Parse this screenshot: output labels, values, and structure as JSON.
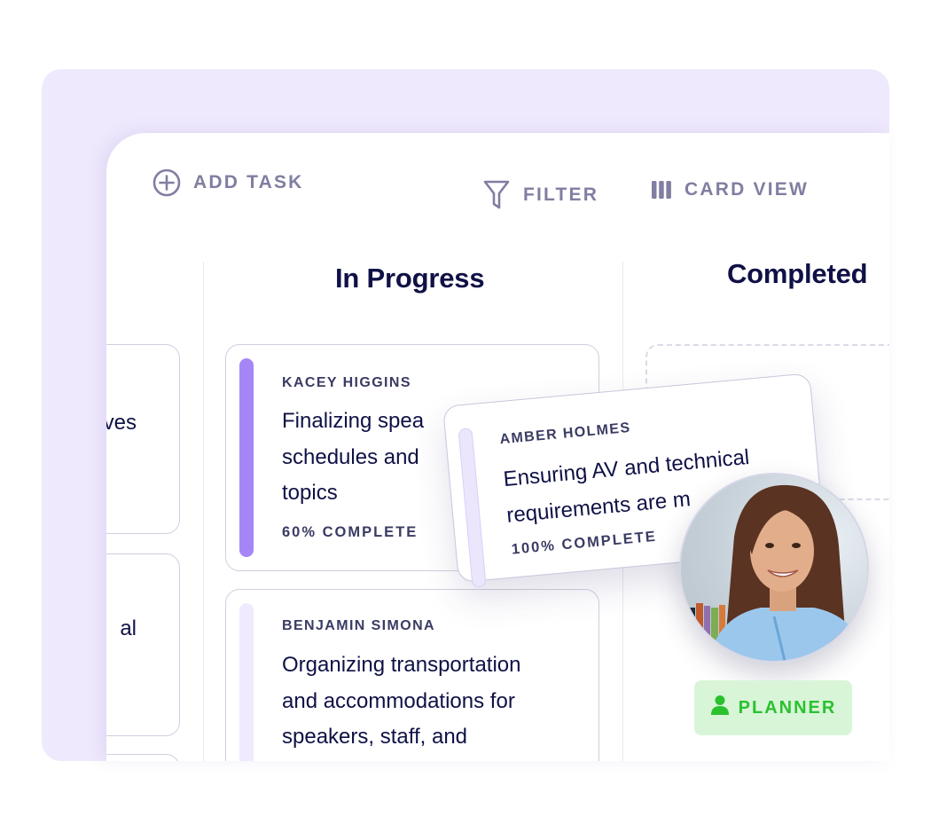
{
  "toolbar": {
    "add_task": {
      "label": "ADD TASK",
      "icon": "plus-circle-icon"
    },
    "filter": {
      "label": "FILTER",
      "icon": "filter-funnel-icon"
    },
    "card_view": {
      "label": "CARD VIEW",
      "icon": "columns-icon"
    }
  },
  "columns": {
    "left_partial": {
      "cards": [
        {
          "text_fragment": "ves"
        },
        {
          "text_fragment": "al"
        }
      ]
    },
    "in_progress": {
      "title": "In Progress",
      "cards": [
        {
          "assignee": "KACEY HIGGINS",
          "lines": [
            "Finalizing spea",
            "schedules and",
            "topics"
          ],
          "progress_label": "60% COMPLETE",
          "progress": 0.6,
          "accent_color": "#a685f7"
        },
        {
          "assignee": "BENJAMIN SIMONA",
          "lines": [
            "Organizing transportation",
            "and accommodations for",
            "speakers, staff, and"
          ],
          "accent_color": "#efeafd"
        }
      ]
    },
    "completed": {
      "title": "Completed"
    }
  },
  "dragging_card": {
    "assignee": "AMBER HOLMES",
    "lines": [
      "Ensuring AV and technical",
      "requirements are m"
    ],
    "progress_label": "100% COMPLETE",
    "progress": 1.0,
    "accent_color": "#ece6fd"
  },
  "user": {
    "avatar": "user-avatar-photo",
    "role_badge": {
      "label": "PLANNER",
      "icon": "person-icon",
      "color": "#2ac12f",
      "background": "#d8f5d8"
    }
  },
  "colors": {
    "backdrop": "#efe9fd",
    "text_dark": "#0f1146",
    "toolbar_text": "#807ea1"
  }
}
